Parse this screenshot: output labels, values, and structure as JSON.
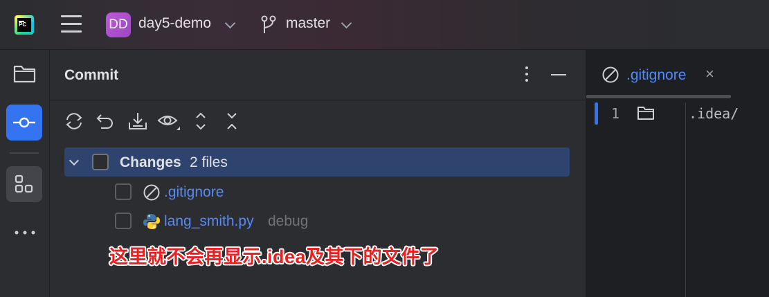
{
  "titlebar": {
    "app_logo_text": "PC",
    "project_badge": "DD",
    "project_name": "day5-demo",
    "branch_name": "master"
  },
  "toolstrip": {
    "items": [
      {
        "icon": "folder-icon",
        "active": false
      },
      {
        "icon": "commit-icon",
        "active": true
      },
      {
        "icon": "structure-icon",
        "active": false
      },
      {
        "icon": "more-icon",
        "active": false
      }
    ]
  },
  "commit_panel": {
    "title": "Commit",
    "toolbar_icons": [
      "refresh-icon",
      "rollback-icon",
      "shelve-icon",
      "preview-diff-icon",
      "expand-all-icon",
      "collapse-all-icon"
    ],
    "changes": {
      "label": "Changes",
      "count": "2 files",
      "files": [
        {
          "name": ".gitignore",
          "icon": "ignored-file-icon",
          "hint": ""
        },
        {
          "name": "lang_smith.py",
          "icon": "python-icon",
          "hint": "debug"
        }
      ]
    },
    "annotation": "这里就不会再显示.idea及其下的文件了"
  },
  "editor": {
    "tab_label": ".gitignore",
    "tab_close": "×",
    "line_number": "1",
    "code": ".idea/"
  },
  "colors": {
    "accent": "#3574f0",
    "link": "#548af7",
    "selection": "#2e436e",
    "annotation_red": "#e8201f",
    "badge_purple": "#b554d3"
  }
}
